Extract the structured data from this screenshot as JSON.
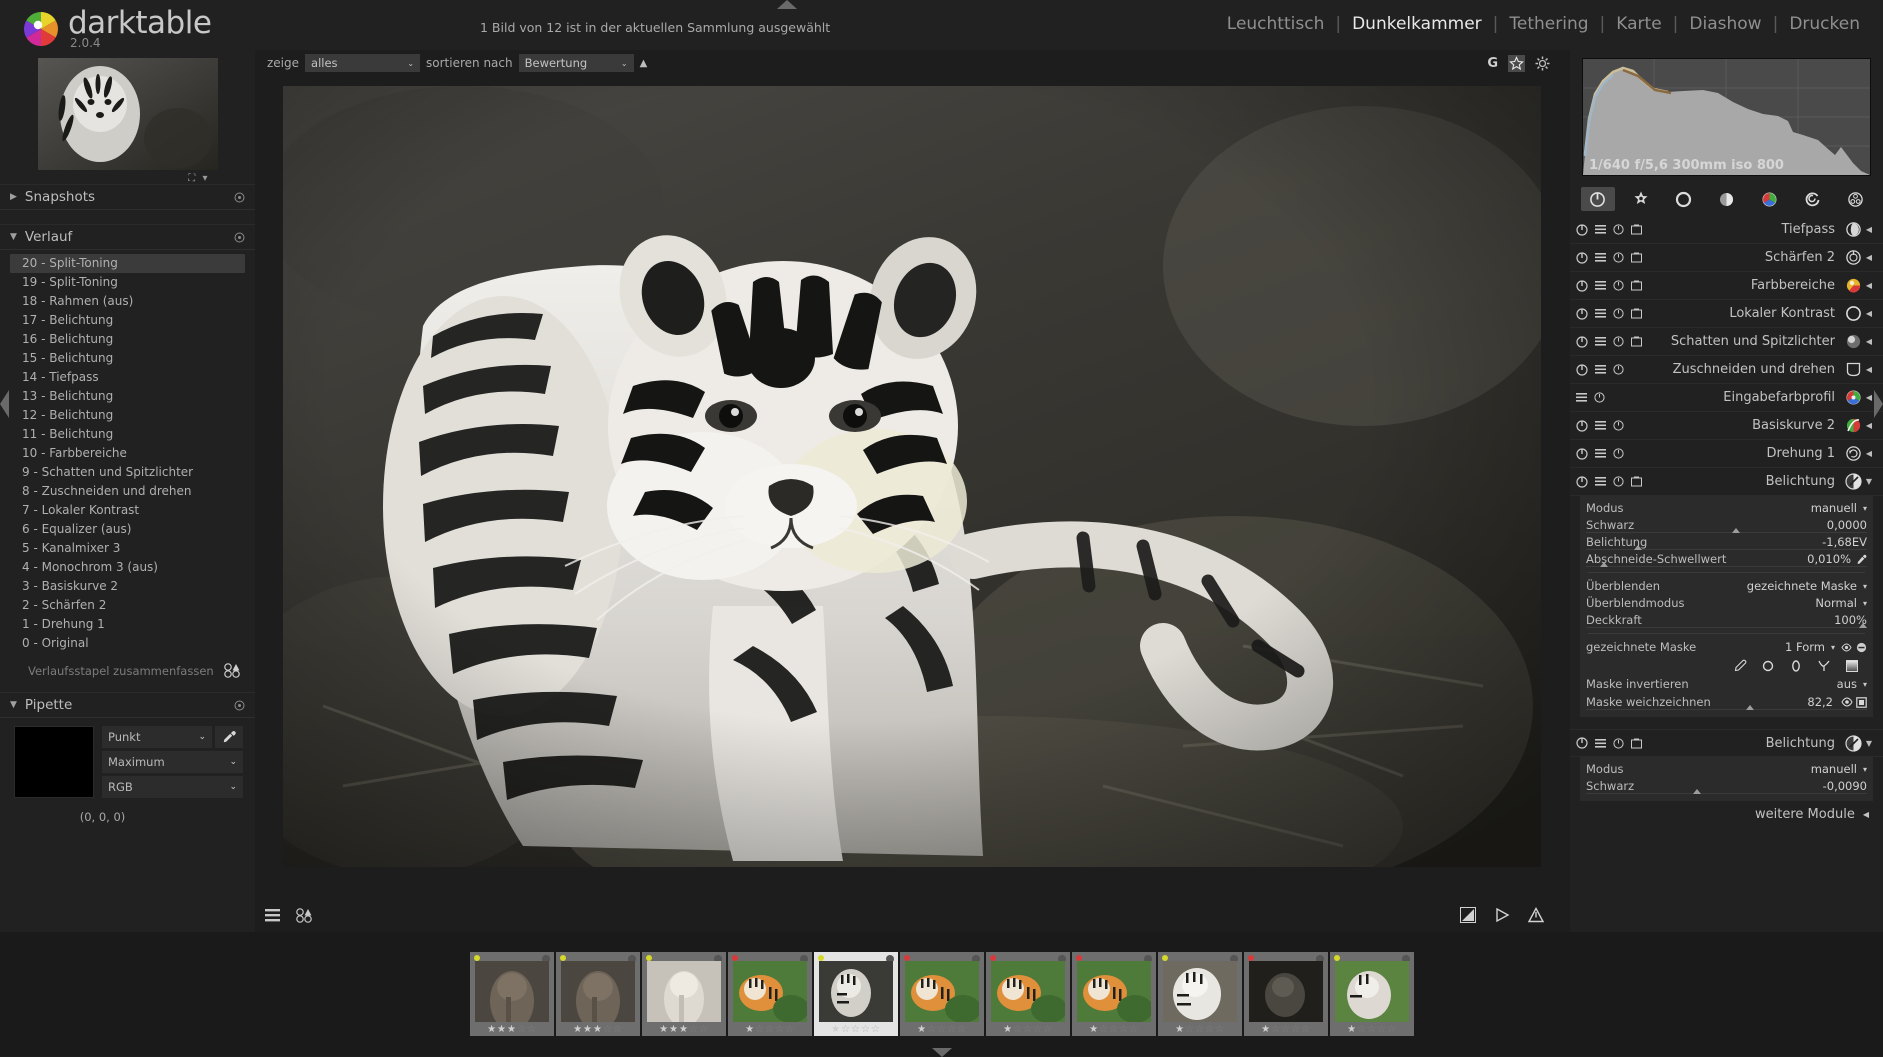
{
  "app": {
    "name": "darktable",
    "version": "2.0.4",
    "logo_colors": [
      "#e03a3a",
      "#e8902a",
      "#e8d32a",
      "#4fae3a",
      "#2aa9d8",
      "#7b3ad8",
      "#d02a9a",
      "#c8c8c8"
    ]
  },
  "header": {
    "collection_status": "1 Bild von 12 ist in der aktuellen Sammlung ausgewählt",
    "nav": [
      {
        "label": "Leuchttisch",
        "active": false
      },
      {
        "label": "Dunkelkammer",
        "active": true
      },
      {
        "label": "Tethering",
        "active": false
      },
      {
        "label": "Karte",
        "active": false
      },
      {
        "label": "Diashow",
        "active": false
      },
      {
        "label": "Drucken",
        "active": false
      }
    ],
    "nav_separator": "|"
  },
  "center_toolbar": {
    "show_label": "zeige",
    "show_value": "alles",
    "sort_label": "sortieren nach",
    "sort_value": "Bewertung",
    "sort_dir_icon": "sort-ascending-icon",
    "grouping_badge": "G",
    "overlay_icon": "star-overlay-icon",
    "prefs_icon": "gear-icon"
  },
  "left_panel": {
    "navigation": {
      "zoom_fit_icon": "fit-to-screen-icon",
      "zoom_menu_icon": "chevron-down-icon"
    },
    "snapshots": {
      "title": "Snapshots",
      "collapsed": true,
      "reset_icon": "reset-icon"
    },
    "history": {
      "title": "Verlauf",
      "collapsed": false,
      "reset_icon": "reset-icon",
      "items": [
        {
          "label": "20 - Split-Toning",
          "selected": true
        },
        {
          "label": "19 - Split-Toning",
          "selected": false
        },
        {
          "label": "18 - Rahmen  (aus)",
          "selected": false
        },
        {
          "label": "17 - Belichtung",
          "selected": false
        },
        {
          "label": "16 - Belichtung",
          "selected": false
        },
        {
          "label": "15 - Belichtung",
          "selected": false
        },
        {
          "label": "14 - Tiefpass",
          "selected": false
        },
        {
          "label": "13 - Belichtung",
          "selected": false
        },
        {
          "label": "12 - Belichtung",
          "selected": false
        },
        {
          "label": "11 - Belichtung",
          "selected": false
        },
        {
          "label": "10 - Farbbereiche",
          "selected": false
        },
        {
          "label": "9 - Schatten und Spitzlichter",
          "selected": false
        },
        {
          "label": "8 - Zuschneiden und drehen",
          "selected": false
        },
        {
          "label": "7 - Lokaler Kontrast",
          "selected": false
        },
        {
          "label": "6 - Equalizer  (aus)",
          "selected": false
        },
        {
          "label": "5 - Kanalmixer 3",
          "selected": false
        },
        {
          "label": "4 - Monochrom 3 (aus)",
          "selected": false
        },
        {
          "label": "3 - Basiskurve 2",
          "selected": false
        },
        {
          "label": "2 - Schärfen 2",
          "selected": false
        },
        {
          "label": "1 - Drehung 1",
          "selected": false
        },
        {
          "label": "0 - Original",
          "selected": false
        }
      ],
      "compress_label": "Verlaufsstapel zusammenfassen",
      "compress_icon": "compress-stack-icon"
    },
    "pipette": {
      "title": "Pipette",
      "reset_icon": "reset-icon",
      "swatch_color": "#000000",
      "mode_value": "Punkt",
      "picker_icon": "eyedropper-icon",
      "statistic_value": "Maximum",
      "colorspace_value": "RGB",
      "values_text": "(0, 0, 0)"
    }
  },
  "right_panel": {
    "histogram": {
      "exif": "1/640 f/5,6 300mm iso 800"
    },
    "module_groups": [
      {
        "name": "active-modules-group",
        "icon": "power-icon",
        "active": true
      },
      {
        "name": "favorites-group",
        "icon": "star-icon",
        "active": false
      },
      {
        "name": "basic-group",
        "icon": "circle-ring-icon",
        "active": false
      },
      {
        "name": "tone-group",
        "icon": "half-circle-icon",
        "active": false
      },
      {
        "name": "color-group",
        "icon": "color-wheel-icon",
        "active": false
      },
      {
        "name": "correction-group",
        "icon": "swirl-icon",
        "active": false
      },
      {
        "name": "effects-group",
        "icon": "effects-icon",
        "active": false
      }
    ],
    "modules": [
      {
        "name": "Tiefpass",
        "icon": "lowpass-icon",
        "has_power": true,
        "has_multi": true,
        "has_reset": true,
        "has_presets": true,
        "expanded": false
      },
      {
        "name": "Schärfen 2",
        "icon": "sharpen-icon",
        "has_power": true,
        "has_multi": true,
        "has_reset": true,
        "has_presets": true,
        "expanded": false
      },
      {
        "name": "Farbbereiche",
        "icon": "colorzones-icon",
        "has_power": true,
        "has_multi": true,
        "has_reset": true,
        "has_presets": true,
        "expanded": false
      },
      {
        "name": "Lokaler Kontrast",
        "icon": "localcontrast-icon",
        "has_power": true,
        "has_multi": true,
        "has_reset": true,
        "has_presets": true,
        "expanded": false
      },
      {
        "name": "Schatten und Spitzlichter",
        "icon": "shadhi-icon",
        "has_power": true,
        "has_multi": true,
        "has_reset": true,
        "has_presets": true,
        "expanded": false
      },
      {
        "name": "Zuschneiden und drehen",
        "icon": "crop-icon",
        "has_power": true,
        "has_multi": true,
        "has_reset": true,
        "has_presets": false,
        "expanded": false
      },
      {
        "name": "Eingabefarbprofil",
        "icon": "colorin-icon",
        "has_power": false,
        "has_multi": true,
        "has_reset": true,
        "has_presets": false,
        "expanded": false
      },
      {
        "name": "Basiskurve 2",
        "icon": "basecurve-icon",
        "has_power": true,
        "has_multi": true,
        "has_reset": true,
        "has_presets": false,
        "expanded": false
      },
      {
        "name": "Drehung 1",
        "icon": "rotate-icon",
        "has_power": true,
        "has_multi": true,
        "has_reset": true,
        "has_presets": false,
        "expanded": false
      }
    ],
    "exposure_module": {
      "name": "Belichtung",
      "icon": "exposure-icon",
      "expanded": true,
      "params": [
        {
          "label": "Modus",
          "value": "manuell",
          "type": "combo"
        },
        {
          "label": "Schwarz",
          "value": "0,0000",
          "type": "slider",
          "pos": 52
        },
        {
          "label": "Belichtung",
          "value": "-1,68EV",
          "type": "slider",
          "pos": 17
        },
        {
          "label": "Abschneide-Schwellwert",
          "value": "0,010%",
          "type": "slider",
          "pos": 5,
          "extra_icon": "picker-icon"
        }
      ],
      "blend": [
        {
          "label": "Überblenden",
          "value": "gezeichnete Maske",
          "type": "combo"
        },
        {
          "label": "Überblendmodus",
          "value": "Normal",
          "type": "combo"
        },
        {
          "label": "Deckkraft",
          "value": "100%",
          "type": "slider",
          "pos": 97
        }
      ],
      "mask": {
        "label": "gezeichnete Maske",
        "value": "1 Form",
        "show_mask_icon": "show-mask-icon",
        "remove_icon": "remove-shape-icon",
        "shapes": [
          "brush-icon",
          "circle-icon",
          "ellipse-icon",
          "path-icon",
          "gradient-icon"
        ]
      },
      "invert": {
        "label": "Maske invertieren",
        "value": "aus"
      },
      "feather": {
        "label": "Maske weichzeichnen",
        "value": "82,2",
        "pos": 57,
        "eye_icon": "toggle-mask-icon",
        "box_icon": "mask-display-icon"
      }
    },
    "exposure_module2": {
      "name": "Belichtung",
      "icon": "exposure-icon",
      "expanded": true,
      "params": [
        {
          "label": "Modus",
          "value": "manuell",
          "type": "combo"
        },
        {
          "label": "Schwarz",
          "value": "-0,0090",
          "type": "slider",
          "pos": 38
        }
      ]
    },
    "more_modules": {
      "label": "weitere Module",
      "icon": "chevron-left-icon"
    }
  },
  "bottom_toolbar": {
    "left_icons": [
      "filmstrip-toggle-icon",
      "duplicate-manager-icon"
    ],
    "right_icons": [
      "softproof-icon",
      "gamut-check-icon",
      "warning-icon"
    ]
  },
  "filmstrip": {
    "thumbnails": [
      {
        "dot": "#d8d82a",
        "stars": 3,
        "kind": "elephant-dark",
        "active": false
      },
      {
        "dot": "#d8d82a",
        "stars": 3,
        "kind": "elephant-dark",
        "active": false
      },
      {
        "dot": "#d8d82a",
        "stars": 3,
        "kind": "elephant-light",
        "active": false
      },
      {
        "dot": "#d83a3a",
        "stars": 1,
        "kind": "tiger-color",
        "active": false
      },
      {
        "dot": "#d8d82a",
        "stars": 1,
        "kind": "tiger-bw",
        "active": true
      },
      {
        "dot": "#d83a3a",
        "stars": 1,
        "kind": "tiger-color",
        "active": false
      },
      {
        "dot": "#d83a3a",
        "stars": 1,
        "kind": "tiger-color",
        "active": false
      },
      {
        "dot": "#d83a3a",
        "stars": 1,
        "kind": "tiger-color",
        "active": false
      },
      {
        "dot": "#d8d82a",
        "stars": 1,
        "kind": "tiger-white",
        "active": false
      },
      {
        "dot": "#d83a3a",
        "stars": 1,
        "kind": "tiger-dark",
        "active": false
      },
      {
        "dot": "#d8d82a",
        "stars": 1,
        "kind": "tiger-green",
        "active": false
      }
    ],
    "star_filled": "★",
    "star_empty": "☆"
  }
}
